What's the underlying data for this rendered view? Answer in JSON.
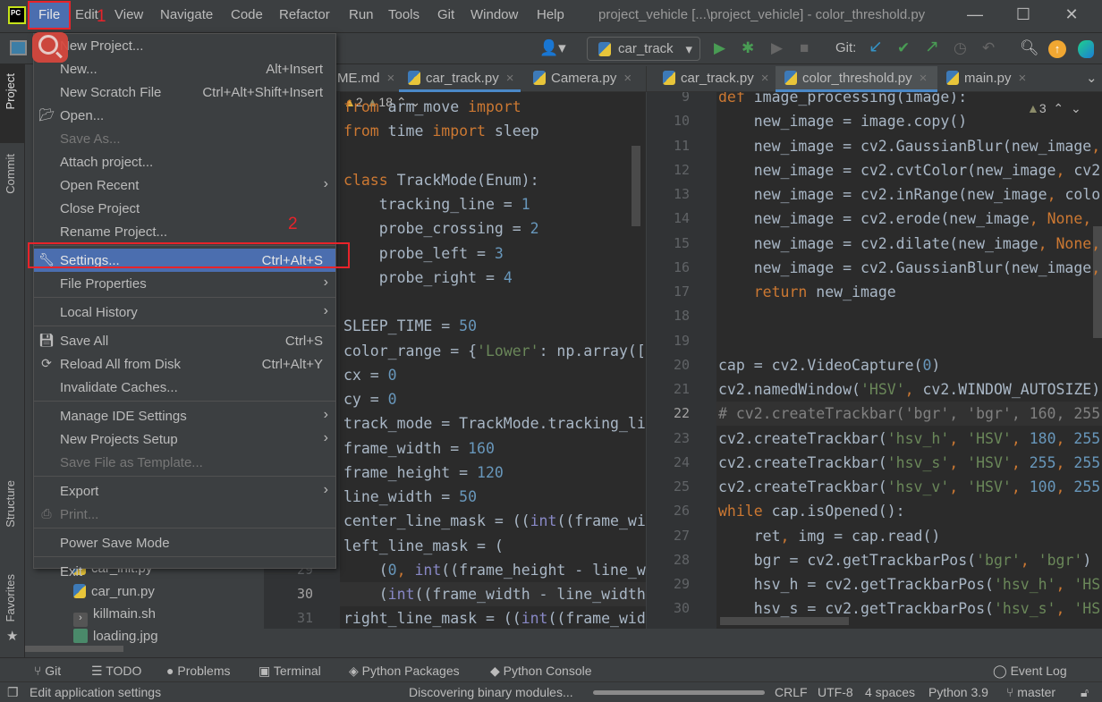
{
  "menubar": {
    "items": [
      "File",
      "Edit",
      "View",
      "Navigate",
      "Code",
      "Refactor",
      "Run",
      "Tools",
      "Git",
      "Window",
      "Help"
    ],
    "title": "project_vehicle [...\\project_vehicle] - color_threshold.py"
  },
  "toolbar": {
    "run_config": "car_track",
    "git_label": "Git:"
  },
  "left_strip": {
    "project": "Project",
    "commit": "Commit",
    "structure": "Structure",
    "favorites": "Favorites"
  },
  "project_tree": [
    "car_init.py",
    "car_run.py",
    "killmain.sh",
    "loading.jpg"
  ],
  "left_tabs": [
    {
      "label": "ME.md"
    },
    {
      "label": "car_track.py",
      "active": true
    },
    {
      "label": "Camera.py"
    }
  ],
  "right_tabs": [
    {
      "label": "car_track.py"
    },
    {
      "label": "color_threshold.py",
      "active": true
    },
    {
      "label": "main.py"
    }
  ],
  "left_editor": {
    "warnings": "2",
    "weak_warnings": "18",
    "first_line": 10,
    "current_line": 30,
    "lines": [
      [
        [
          "k",
          "from"
        ],
        [
          "t",
          " arm_move "
        ],
        [
          "k",
          "import"
        ]
      ],
      [
        [
          "k",
          "from"
        ],
        [
          "t",
          " time "
        ],
        [
          "k",
          "import"
        ],
        [
          "t",
          " sleep"
        ]
      ],
      [],
      [
        [
          "k",
          "class"
        ],
        [
          "t",
          " TrackMode(Enum):"
        ]
      ],
      [
        [
          "t",
          "    tracking_line = "
        ],
        [
          "n",
          "1"
        ]
      ],
      [
        [
          "t",
          "    probe_crossing = "
        ],
        [
          "n",
          "2"
        ]
      ],
      [
        [
          "t",
          "    probe_left = "
        ],
        [
          "n",
          "3"
        ]
      ],
      [
        [
          "t",
          "    probe_right = "
        ],
        [
          "n",
          "4"
        ]
      ],
      [],
      [
        [
          "t",
          "SLEEP_TIME = "
        ],
        [
          "n",
          "50"
        ]
      ],
      [
        [
          "t",
          "color_range = {"
        ],
        [
          "s",
          "'Lower'"
        ],
        [
          "t",
          ": np.array(["
        ]
      ],
      [
        [
          "t",
          "cx = "
        ],
        [
          "n",
          "0"
        ]
      ],
      [
        [
          "t",
          "cy = "
        ],
        [
          "n",
          "0"
        ]
      ],
      [
        [
          "t",
          "track_mode = TrackMode.tracking_line"
        ]
      ],
      [
        [
          "t",
          "frame_width = "
        ],
        [
          "n",
          "160"
        ]
      ],
      [
        [
          "t",
          "frame_height = "
        ],
        [
          "n",
          "120"
        ]
      ],
      [
        [
          "t",
          "line_width = "
        ],
        [
          "n",
          "50"
        ]
      ],
      [
        [
          "t",
          "center_line_mask = (("
        ],
        [
          "b",
          "int"
        ],
        [
          "t",
          "((frame_width"
        ]
      ],
      [
        [
          "t",
          "left_line_mask = ("
        ]
      ],
      [
        [
          "t",
          "    ("
        ],
        [
          "n",
          "0"
        ],
        [
          "k",
          ", "
        ],
        [
          "b",
          "int"
        ],
        [
          "t",
          "((frame_height - line_width"
        ]
      ],
      [
        [
          "t",
          "    ("
        ],
        [
          "b",
          "int"
        ],
        [
          "t",
          "((frame_width - line_width"
        ]
      ],
      [
        [
          "t",
          "right_line_mask = (("
        ],
        [
          "b",
          "int"
        ],
        [
          "t",
          "((frame_width"
        ]
      ]
    ]
  },
  "right_editor": {
    "warnings": "3",
    "first_line": 9,
    "current_line": 22,
    "lines": [
      [
        [
          "k",
          "def"
        ],
        [
          "t",
          " image_processing(image):"
        ]
      ],
      [
        [
          "t",
          "    new_image = image.copy()"
        ]
      ],
      [
        [
          "t",
          "    new_image = cv2.GaussianBlur(new_image"
        ],
        [
          "k",
          ", "
        ]
      ],
      [
        [
          "t",
          "    new_image = cv2.cvtColor(new_image"
        ],
        [
          "k",
          ", "
        ],
        [
          "t",
          "cv2"
        ]
      ],
      [
        [
          "t",
          "    new_image = cv2.inRange(new_image"
        ],
        [
          "k",
          ", "
        ],
        [
          "t",
          "color"
        ]
      ],
      [
        [
          "t",
          "    new_image = cv2.erode(new_image"
        ],
        [
          "k",
          ", "
        ],
        [
          "k",
          "None,"
        ]
      ],
      [
        [
          "t",
          "    new_image = cv2.dilate(new_image"
        ],
        [
          "k",
          ", "
        ],
        [
          "k",
          "None,"
        ]
      ],
      [
        [
          "t",
          "    new_image = cv2.GaussianBlur(new_image"
        ],
        [
          "k",
          ", "
        ]
      ],
      [
        [
          "t",
          "    "
        ],
        [
          "k",
          "return"
        ],
        [
          "t",
          " new_image"
        ]
      ],
      [],
      [],
      [
        [
          "t",
          "cap = cv2.VideoCapture("
        ],
        [
          "n",
          "0"
        ],
        [
          "t",
          ")"
        ]
      ],
      [
        [
          "t",
          "cv2.namedWindow("
        ],
        [
          "s",
          "'HSV'"
        ],
        [
          "k",
          ", "
        ],
        [
          "t",
          "cv2.WINDOW_AUTOSIZE)"
        ]
      ],
      [
        [
          "c",
          "# cv2.createTrackbar('bgr', 'bgr', 160, 255"
        ]
      ],
      [
        [
          "t",
          "cv2.createTrackbar("
        ],
        [
          "s",
          "'hsv_h'"
        ],
        [
          "k",
          ", "
        ],
        [
          "s",
          "'HSV'"
        ],
        [
          "k",
          ", "
        ],
        [
          "n",
          "180"
        ],
        [
          "k",
          ", "
        ],
        [
          "n",
          "255"
        ]
      ],
      [
        [
          "t",
          "cv2.createTrackbar("
        ],
        [
          "s",
          "'hsv_s'"
        ],
        [
          "k",
          ", "
        ],
        [
          "s",
          "'HSV'"
        ],
        [
          "k",
          ", "
        ],
        [
          "n",
          "255"
        ],
        [
          "k",
          ", "
        ],
        [
          "n",
          "255"
        ]
      ],
      [
        [
          "t",
          "cv2.createTrackbar("
        ],
        [
          "s",
          "'hsv_v'"
        ],
        [
          "k",
          ", "
        ],
        [
          "s",
          "'HSV'"
        ],
        [
          "k",
          ", "
        ],
        [
          "n",
          "100"
        ],
        [
          "k",
          ", "
        ],
        [
          "n",
          "255"
        ]
      ],
      [
        [
          "k",
          "while"
        ],
        [
          "t",
          " cap.isOpened():"
        ]
      ],
      [
        [
          "t",
          "    ret"
        ],
        [
          "k",
          ", "
        ],
        [
          "t",
          "img = cap.read()"
        ]
      ],
      [
        [
          "t",
          "    bgr = cv2.getTrackbarPos("
        ],
        [
          "s",
          "'bgr'"
        ],
        [
          "k",
          ", "
        ],
        [
          "s",
          "'bgr'"
        ],
        [
          "t",
          ")"
        ]
      ],
      [
        [
          "t",
          "    hsv_h = cv2.getTrackbarPos("
        ],
        [
          "s",
          "'hsv_h'"
        ],
        [
          "k",
          ", "
        ],
        [
          "s",
          "'HS"
        ]
      ],
      [
        [
          "t",
          "    hsv_s = cv2.getTrackbarPos("
        ],
        [
          "s",
          "'hsv_s'"
        ],
        [
          "k",
          ", "
        ],
        [
          "s",
          "'HS"
        ]
      ]
    ]
  },
  "file_menu": [
    {
      "label": "New Project..."
    },
    {
      "label": "New...",
      "shortcut": "Alt+Insert"
    },
    {
      "label": "New Scratch File",
      "shortcut": "Ctrl+Alt+Shift+Insert"
    },
    {
      "label": "Open...",
      "icon": "folder-icon"
    },
    {
      "label": "Save As...",
      "disabled": true
    },
    {
      "label": "Attach project..."
    },
    {
      "label": "Open Recent",
      "submenu": true
    },
    {
      "label": "Close Project"
    },
    {
      "label": "Rename Project..."
    },
    {
      "sep": true
    },
    {
      "label": "Settings...",
      "shortcut": "Ctrl+Alt+S",
      "icon": "wrench-icon",
      "selected": true
    },
    {
      "label": "File Properties",
      "submenu": true
    },
    {
      "sep": true
    },
    {
      "label": "Local History",
      "submenu": true
    },
    {
      "sep": true
    },
    {
      "label": "Save All",
      "shortcut": "Ctrl+S",
      "icon": "save-icon"
    },
    {
      "label": "Reload All from Disk",
      "shortcut": "Ctrl+Alt+Y",
      "icon": "reload-icon"
    },
    {
      "label": "Invalidate Caches..."
    },
    {
      "sep": true
    },
    {
      "label": "Manage IDE Settings",
      "submenu": true
    },
    {
      "label": "New Projects Setup",
      "submenu": true
    },
    {
      "label": "Save File as Template...",
      "disabled": true
    },
    {
      "sep": true
    },
    {
      "label": "Export",
      "submenu": true
    },
    {
      "label": "Print...",
      "disabled": true,
      "icon": "print-icon"
    },
    {
      "sep": true
    },
    {
      "label": "Power Save Mode"
    },
    {
      "sep": true
    },
    {
      "label": "Exit"
    }
  ],
  "annotations": {
    "step1": "1",
    "step2": "2"
  },
  "bottom_tools": {
    "git": "Git",
    "todo": "TODO",
    "problems": "Problems",
    "terminal": "Terminal",
    "packages": "Python Packages",
    "console": "Python Console",
    "event_log": "Event Log"
  },
  "status": {
    "hint": "Edit application settings",
    "progress_text": "Discovering binary modules...",
    "line_sep": "CRLF",
    "encoding": "UTF-8",
    "indent": "4 spaces",
    "interpreter": "Python 3.9",
    "branch": "master"
  },
  "colors": {
    "accent": "#4b6eaf",
    "annotation": "#e8232a",
    "keyword": "#cc7832",
    "number": "#6897bb",
    "string": "#6a8759"
  }
}
